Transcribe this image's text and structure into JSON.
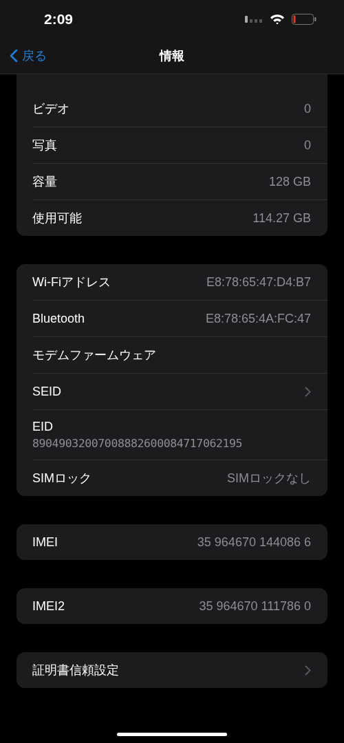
{
  "status_bar": {
    "time": "2:09"
  },
  "nav": {
    "back_label": "戻る",
    "title": "情報"
  },
  "groups": [
    {
      "clipped_top": true,
      "rows": [
        {
          "kind": "value",
          "label": "ビデオ",
          "value": "0"
        },
        {
          "kind": "value",
          "label": "写真",
          "value": "0"
        },
        {
          "kind": "value",
          "label": "容量",
          "value": "128 GB"
        },
        {
          "kind": "value",
          "label": "使用可能",
          "value": "114.27 GB"
        }
      ]
    },
    {
      "clipped_top": false,
      "rows": [
        {
          "kind": "value",
          "label": "Wi-Fiアドレス",
          "value": "E8:78:65:47:D4:B7"
        },
        {
          "kind": "value",
          "label": "Bluetooth",
          "value": "E8:78:65:4A:FC:47"
        },
        {
          "kind": "value",
          "label": "モデムファームウェア"
        },
        {
          "kind": "chevron",
          "label": "SEID"
        },
        {
          "kind": "stacked",
          "label": "EID",
          "value": "89049032007008882600084717062195"
        },
        {
          "kind": "value",
          "label": "SIMロック",
          "value": "SIMロックなし"
        }
      ]
    },
    {
      "clipped_top": false,
      "rows": [
        {
          "kind": "value",
          "label": "IMEI",
          "value": "35 964670 144086 6"
        }
      ]
    },
    {
      "clipped_top": false,
      "rows": [
        {
          "kind": "value",
          "label": "IMEI2",
          "value": "35 964670 111786 0"
        }
      ]
    },
    {
      "clipped_top": false,
      "rows": [
        {
          "kind": "chevron",
          "label": "証明書信頼設定"
        }
      ]
    }
  ]
}
